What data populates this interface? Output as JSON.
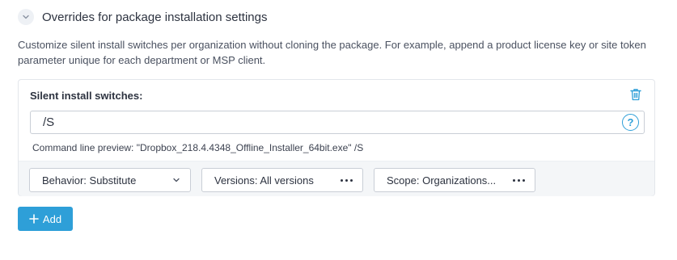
{
  "section": {
    "title": "Overrides for package installation settings",
    "description": "Customize silent install switches per organization without cloning the package. For example, append a product license key or site token parameter unique for each department or MSP client."
  },
  "override": {
    "label": "Silent install switches:",
    "switches_value": "/S",
    "help_label": "?",
    "preview": "Command line preview: \"Dropbox_218.4.4348_Offline_Installer_64bit.exe\" /S",
    "behavior": "Behavior: Substitute",
    "versions": "Versions: All versions",
    "scope": "Scope: Organizations..."
  },
  "add_button": {
    "label": "Add"
  },
  "colors": {
    "accent": "#2e9fd8",
    "text": "#2d3340",
    "border": "#c9ced6",
    "bar_bg": "#f4f6f8"
  },
  "icons": [
    "chevron-down-icon",
    "trash-icon",
    "help-icon",
    "dropdown-arrow-icon",
    "more-dots-icon",
    "plus-icon"
  ]
}
